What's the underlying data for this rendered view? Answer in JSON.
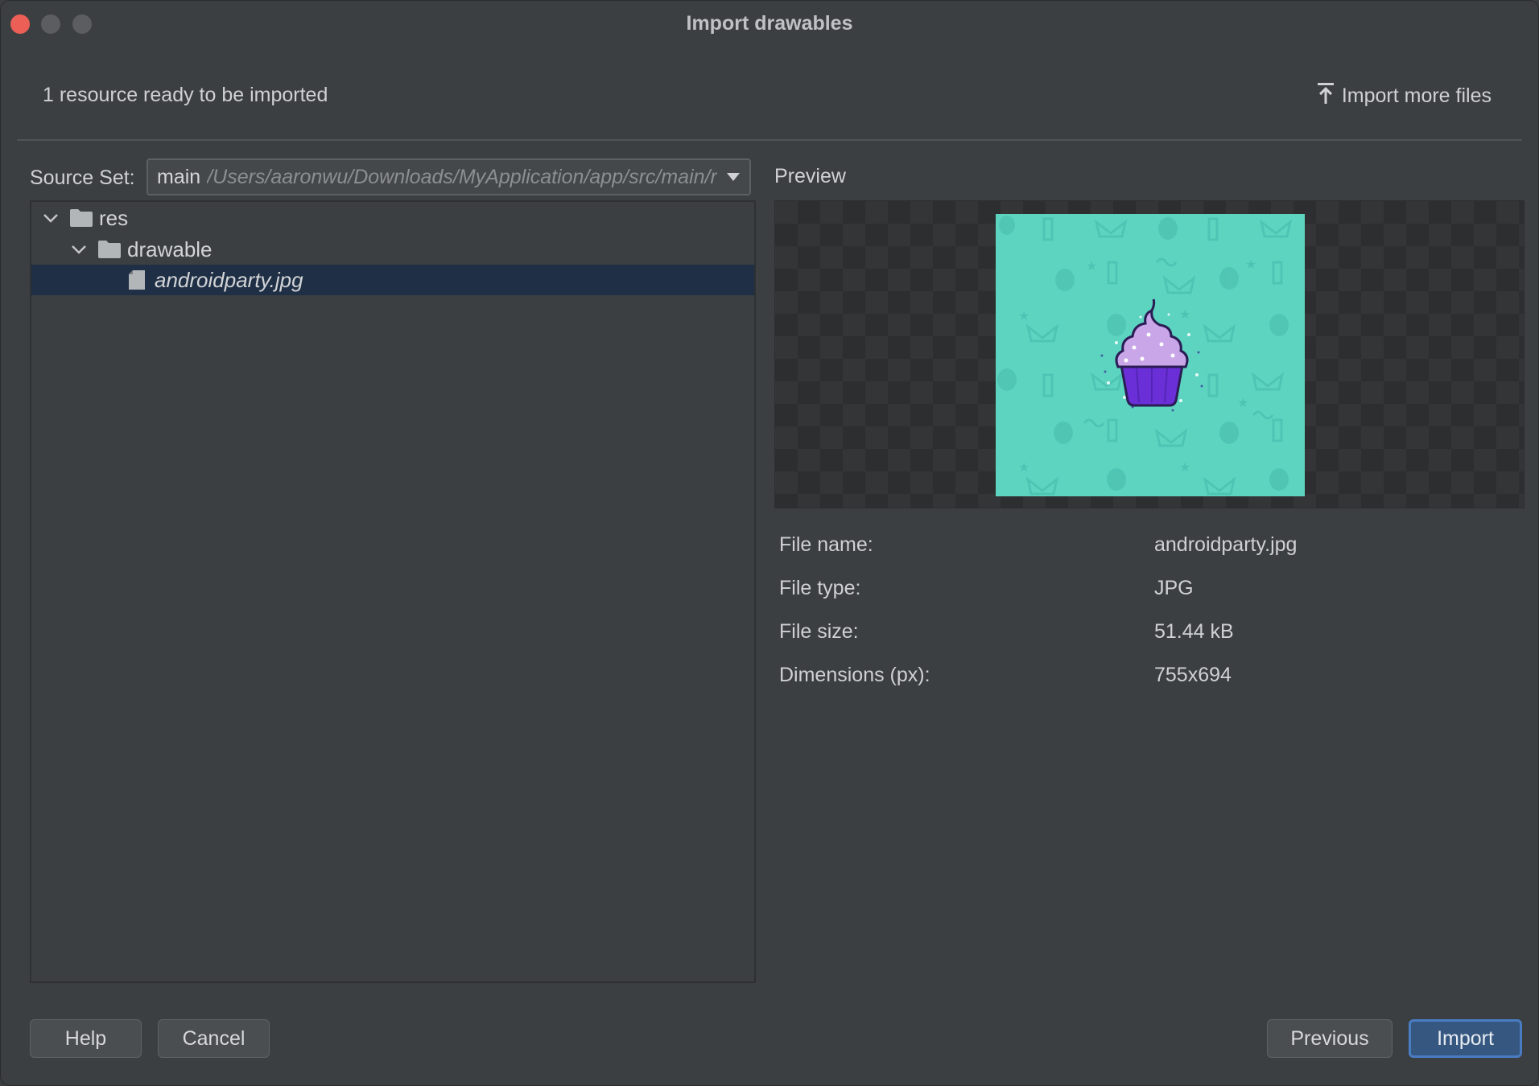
{
  "window": {
    "title": "Import drawables"
  },
  "header": {
    "resource_count": "1 resource ready to be imported",
    "import_more_label": "Import more files",
    "import_more_icon": "upload-icon"
  },
  "source_set": {
    "label": "Source Set:",
    "selected_name": "main",
    "selected_path": "/Users/aaronwu/Downloads/MyApplication/app/src/main/res"
  },
  "tree": {
    "items": [
      {
        "label": "res",
        "icon": "folder-icon",
        "expanded": true
      },
      {
        "label": "drawable",
        "icon": "folder-icon",
        "expanded": true
      },
      {
        "label": "androidparty.jpg",
        "icon": "file-icon",
        "selected": true
      }
    ]
  },
  "preview": {
    "label": "Preview"
  },
  "details": {
    "file_name_label": "File name:",
    "file_name_value": "androidparty.jpg",
    "file_type_label": "File type:",
    "file_type_value": "JPG",
    "file_size_label": "File size:",
    "file_size_value": "51.44 kB",
    "dimensions_label": "Dimensions (px):",
    "dimensions_value": "755x694"
  },
  "buttons": {
    "help": "Help",
    "cancel": "Cancel",
    "previous": "Previous",
    "import": "Import"
  },
  "colors": {
    "background": "#3c3f41",
    "selection": "#1f2f45",
    "primary_button": "#365880",
    "preview_teal": "#5dd4c0",
    "cupcake_frosting": "#c9a6e8",
    "cupcake_cup": "#6a2fd6"
  }
}
